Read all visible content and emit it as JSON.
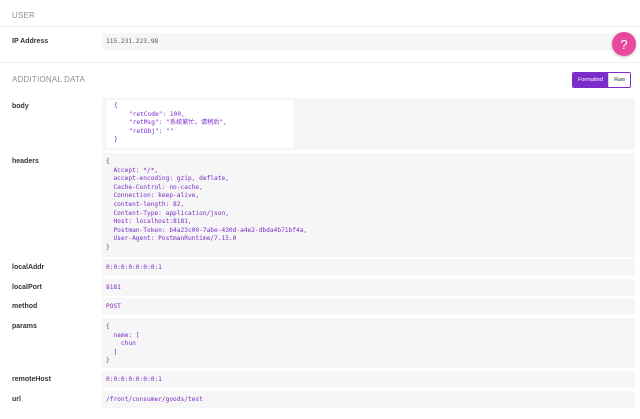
{
  "user": {
    "section_title": "USER",
    "ip_label": "IP Address",
    "ip_value": "115.231.223.98"
  },
  "help_button": "?",
  "additional": {
    "section_title": "ADDITIONAL DATA",
    "toggle_formatted": "Formatted",
    "toggle_raw": "Raw"
  },
  "rows": {
    "body": {
      "label": "body",
      "lines": [
        "{",
        "    \"retCode\": 100,",
        "    \"retMsg\": \"系统繁忙，请稍后\",",
        "    \"retObj\": \"\"",
        "}"
      ]
    },
    "headers": {
      "label": "headers",
      "lines": [
        "{",
        "  Accept: */*,",
        "  accept-encoding: gzip, deflate,",
        "  Cache-Control: no-cache,",
        "  Connection: keep-alive,",
        "  content-length: 82,",
        "  Content-Type: application/json,",
        "  Host: localhost:8181,",
        "  Postman-Token: b4a23c00-7abe-430d-a4e2-dbda4b71bf4a,",
        "  User-Agent: PostmanRuntime/7.15.0",
        "}"
      ]
    },
    "localAddr": {
      "label": "localAddr",
      "value": "0:0:0:0:0:0:0:1"
    },
    "localPort": {
      "label": "localPort",
      "value": "8181"
    },
    "method": {
      "label": "method",
      "value": "POST"
    },
    "params": {
      "label": "params",
      "lines": [
        "{",
        "  name: [",
        "    chun",
        "  ]",
        "}"
      ]
    },
    "remoteHost": {
      "label": "remoteHost",
      "value": "0:0:0:0:0:0:0:1"
    },
    "url": {
      "label": "url",
      "value": "/front/consumer/goods/test"
    }
  }
}
